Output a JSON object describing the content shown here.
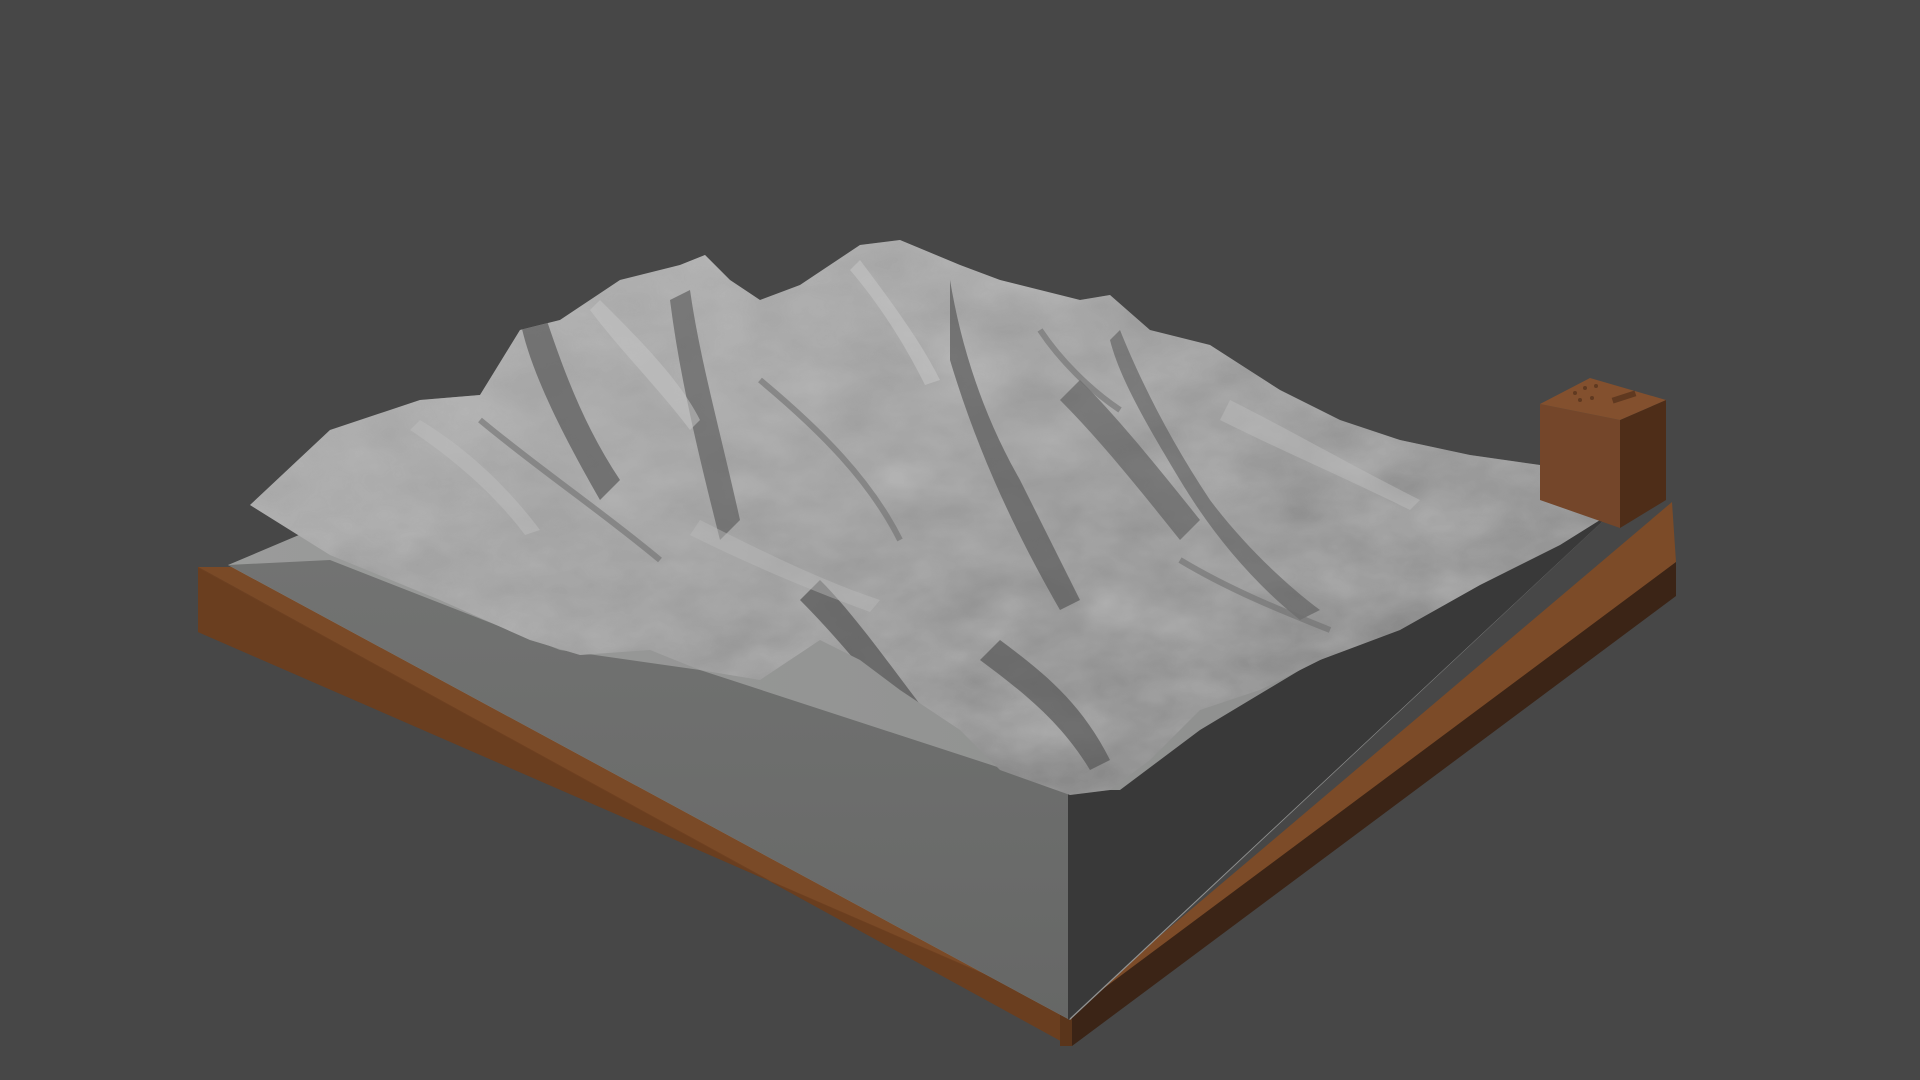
{
  "viewport": {
    "background_color": "#474747"
  },
  "scene": {
    "model": "terrain-relief-model",
    "colors": {
      "terrain_light": "#a9a9a9",
      "terrain_mid": "#8e8e8e",
      "terrain_shadow": "#5c5c5c",
      "block_front_face": "#6c6d6c",
      "block_side_face": "#393939",
      "base_top": "#7a4a27",
      "base_front": "#6c3f20",
      "base_side": "#3b2416",
      "pillar_front": "#74462a",
      "pillar_side": "#4e2d18",
      "pillar_top": "#83502e"
    }
  }
}
